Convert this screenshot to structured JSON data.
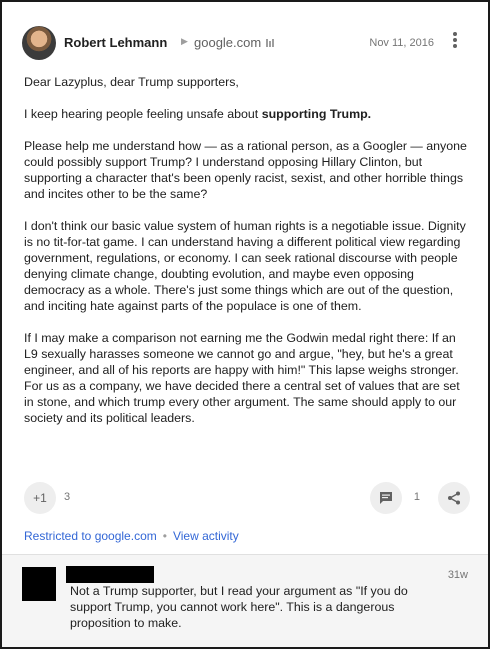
{
  "post": {
    "author": "Robert Lehmann",
    "community": "google.com",
    "date": "Nov 11, 2016",
    "greeting": "Dear Lazyplus, dear Trump supporters,",
    "intro_prefix": "I keep hearing people feeling unsafe about ",
    "intro_bold": "supporting Trump.",
    "para_2": "Please help me understand how — as a rational person, as a Googler — anyone could possibly support Trump?  I understand opposing Hillary Clinton, but supporting a character that's been openly racist, sexist, and other horrible things and incites other to be the same?",
    "para_3": "I don't think our basic value system of human rights is a negotiable issue.  Dignity is no tit-for-tat game.  I can understand having a different political view regarding government, regulations, or economy.  I can seek rational discourse with people denying climate change, doubting evolution, and maybe even opposing democracy as a whole.  There's just some things which are out of the question, and inciting hate against parts of the populace is one of them.",
    "para_4": "If I may make a comparison not earning me the Godwin medal right there:  If an L9 sexually harasses someone we cannot go and argue, \"hey, but he's a great engineer, and all of his reports are happy with him!\"  This lapse weighs stronger.  For us as a company, we have decided there a central set of values that are set in stone, and which trump every other argument.  The same should apply to our society and its political leaders."
  },
  "actions": {
    "plusone_label": "+1",
    "plusone_count": "3",
    "comment_count": "1"
  },
  "meta": {
    "restricted": "Restricted to google.com",
    "separator": "•",
    "view_activity": "View activity"
  },
  "comment": {
    "time": "31w",
    "text": "Not a Trump supporter, but I read your argument as \"If you do support Trump, you cannot work here\". This is a dangerous proposition to make."
  }
}
